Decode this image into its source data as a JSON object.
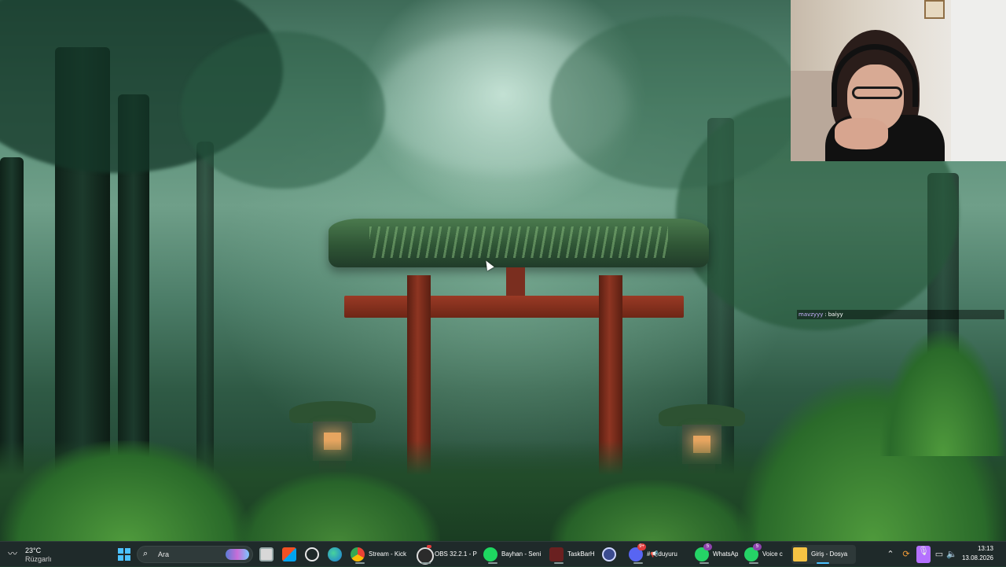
{
  "overlay": {
    "chat": {
      "user": "mavzyyy",
      "separator": ":",
      "message": "baiyy"
    }
  },
  "taskbar": {
    "weather": {
      "temperature": "23°C",
      "condition": "Rüzgarlı",
      "icon": "wind-icon"
    },
    "search": {
      "placeholder": "Ara"
    },
    "apps": [
      {
        "name": "file-explorer",
        "label": "",
        "icon": "folder-icon"
      },
      {
        "name": "microsoft-store",
        "label": "",
        "icon": "store-icon"
      },
      {
        "name": "chatgpt",
        "label": "",
        "icon": "chatgpt-icon"
      },
      {
        "name": "edge",
        "label": "",
        "icon": "edge-icon"
      },
      {
        "name": "chrome",
        "label": "Stream - Kick",
        "icon": "chrome-icon"
      },
      {
        "name": "obs",
        "label": "OBS 32.2.1 - P",
        "icon": "obs-icon"
      },
      {
        "name": "spotify",
        "label": "Bayhan - Seni",
        "icon": "spotify-icon"
      },
      {
        "name": "taskbarh",
        "label": "TaskBarH",
        "icon": "taskbar-icon"
      },
      {
        "name": "settings",
        "label": "",
        "icon": "gear-icon"
      },
      {
        "name": "discord",
        "label": "#📢duyuru",
        "icon": "discord-icon",
        "badge": "9+"
      },
      {
        "name": "whatsapp",
        "label": "WhatsAp",
        "icon": "whatsapp-icon",
        "badge": "5"
      },
      {
        "name": "whatsapp-voice",
        "label": "Voice c",
        "icon": "whatsapp-icon",
        "badge": "5"
      },
      {
        "name": "explorer-window",
        "label": "Giriş - Dosya",
        "icon": "folder-icon"
      }
    ],
    "tray": {
      "clock_time": "13:13",
      "clock_date": "13.08.2026"
    }
  },
  "colors": {
    "taskbar_bg": "#1f2a2a",
    "accent": "#4cc2ff",
    "torii_red": "#8e3522",
    "chat_user": "#c9b3ff"
  }
}
